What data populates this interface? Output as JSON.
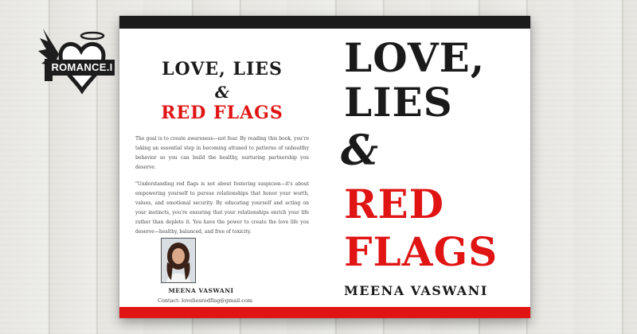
{
  "logo": {
    "text": "ROMANCE.I"
  },
  "back_cover": {
    "title_line1": "LOVE, LIES",
    "ampersand": "&",
    "title_line2": "RED FLAGS",
    "paragraph1": "The goal is to create awareness—not fear. By reading this book, you're taking an essential step in becoming attuned to patterns of unhealthy behavior so you can build the healthy, nurturing partnership you deserve.",
    "paragraph2": "\"Understanding red flags is not about fostering suspicion—it's about empowering yourself to pursue relationships that honor your worth, values, and emotional security. By educating yourself and acting on your instincts, you're ensuring that your relationships enrich your life rather than deplete it. You have the power to create the love life you deserve—healthy, balanced, and free of toxicity.",
    "author": "MEENA VASWANI",
    "contact": "Contact:   loveliesredflag@gmail.com"
  },
  "front_cover": {
    "line1": "LOVE,",
    "line2": "LIES",
    "ampersand": "&",
    "line3": "RED",
    "line4": "FLAGS",
    "author": "MEENA VASWANI"
  },
  "colors": {
    "accent": "#e11414",
    "dark": "#1b1b1b",
    "page": "#ffffff"
  }
}
